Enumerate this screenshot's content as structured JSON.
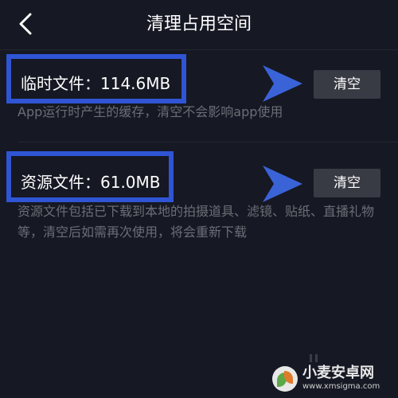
{
  "header": {
    "title": "清理占用空间",
    "back_icon": "chevron-left-icon"
  },
  "items": [
    {
      "title": "临时文件：114.6MB",
      "description": "App运行时产生的缓存，清空不会影响app使用",
      "button_label": "清空"
    },
    {
      "title": "资源文件：61.0MB",
      "description": "资源文件包括已下载到本地的拍摄道具、滤镜、贴纸、直播礼物等，清空后如需再次使用，将会重新下载",
      "button_label": "清空"
    }
  ],
  "annotations": {
    "highlight_color": "#2f55d4",
    "arrow_color": "#3a63d8",
    "arrow_icon": "arrow-right-icon"
  },
  "watermark": {
    "name": "小麦安卓网",
    "url": "www.xmsigma.com"
  },
  "colors": {
    "background": "#161823",
    "button_bg": "#393b44",
    "desc_text": "#6c6e76"
  }
}
